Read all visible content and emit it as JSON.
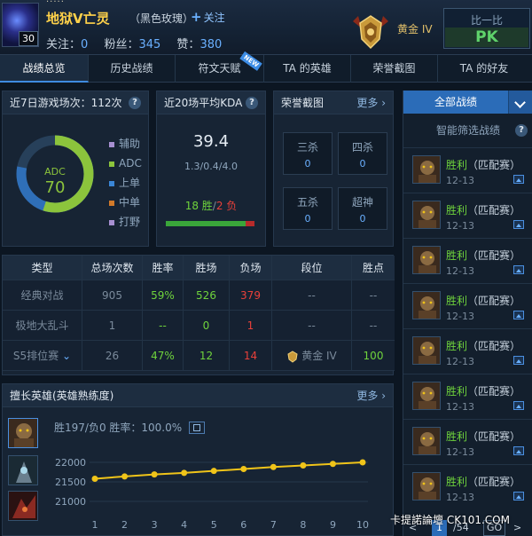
{
  "top_strip": "·····",
  "player": {
    "name": "地狱V亡灵",
    "title": "（黑色玫瑰）",
    "level": "30",
    "follow_label": "关注",
    "follows_label": "关注：",
    "follows": "0",
    "fans_label": "粉丝：",
    "fans": "345",
    "likes_label": "赞：",
    "likes": "380",
    "rank": "黄金 IV"
  },
  "compare": {
    "title": "比一比",
    "pk": "PK"
  },
  "tabs": [
    {
      "label": "战绩总览"
    },
    {
      "label": "历史战绩"
    },
    {
      "label": "符文天赋",
      "badge": "NEW"
    },
    {
      "label": "TA 的英雄"
    },
    {
      "label": "荣誉截图"
    },
    {
      "label": "TA 的好友"
    }
  ],
  "games_panel": {
    "title": "近7日游戏场次：112次",
    "center_role": "ADC",
    "center_value": "70",
    "legend": [
      {
        "label": "辅助",
        "color": "#a78fd1"
      },
      {
        "label": "ADC",
        "color": "#8cc43c"
      },
      {
        "label": "上单",
        "color": "#3a86d6"
      },
      {
        "label": "中单",
        "color": "#d27a2a"
      },
      {
        "label": "打野",
        "color": "#a78fd1"
      }
    ],
    "donut_colors": {
      "adc": "#8cc43c",
      "top": "#2f6fb8",
      "rest": "#27405a"
    }
  },
  "kda_panel": {
    "title": "近20场平均KDA",
    "kda": "39.4",
    "detail": "1.3/0.4/4.0",
    "wins": "18 胜",
    "sep": "/",
    "losses": "2 负",
    "win_ratio": 0.9
  },
  "honor_panel": {
    "title": "荣誉截图",
    "more": "更多",
    "cells": [
      {
        "name": "三杀",
        "value": "0"
      },
      {
        "name": "四杀",
        "value": "0"
      },
      {
        "name": "五杀",
        "value": "0"
      },
      {
        "name": "超神",
        "value": "0"
      }
    ]
  },
  "stats_table": {
    "headers": [
      "类型",
      "总场次数",
      "胜率",
      "胜场",
      "负场",
      "段位",
      "胜点"
    ],
    "rows": [
      {
        "type": "经典对战",
        "total": "905",
        "rate": "59%",
        "wins": "526",
        "losses": "379",
        "rank": "--",
        "points": "--"
      },
      {
        "type": "极地大乱斗",
        "total": "1",
        "rate": "--",
        "wins": "0",
        "losses": "1",
        "rank": "--",
        "points": "--"
      },
      {
        "type": "S5排位赛",
        "total": "26",
        "rate": "47%",
        "wins": "12",
        "losses": "14",
        "rank": "黄金 IV",
        "points": "100"
      }
    ]
  },
  "heroes_panel": {
    "title": "擅长英雄(英雄熟练度)",
    "more": "更多",
    "stats": "胜197/负0   胜率：100.0%"
  },
  "chart_data": {
    "type": "line",
    "x": [
      1,
      2,
      3,
      4,
      5,
      6,
      7,
      8,
      9,
      10
    ],
    "values": [
      21580,
      21640,
      21690,
      21730,
      21780,
      21830,
      21880,
      21920,
      21960,
      22000
    ],
    "ylim": [
      21000,
      22000
    ],
    "yticks": [
      "22000",
      "21500",
      "21000"
    ],
    "xticks": [
      "1",
      "2",
      "3",
      "4",
      "5",
      "6",
      "7",
      "8",
      "9",
      "10"
    ],
    "color": "#f0c419"
  },
  "right": {
    "all_games": "全部战绩",
    "smart_filter": "智能筛选战绩",
    "matches": [
      {
        "result": "胜利",
        "mode": "（匹配赛）",
        "date": "12-13"
      },
      {
        "result": "胜利",
        "mode": "（匹配赛）",
        "date": "12-13"
      },
      {
        "result": "胜利",
        "mode": "（匹配赛）",
        "date": "12-13"
      },
      {
        "result": "胜利",
        "mode": "（匹配赛）",
        "date": "12-13"
      },
      {
        "result": "胜利",
        "mode": "（匹配赛）",
        "date": "12-13"
      },
      {
        "result": "胜利",
        "mode": "（匹配赛）",
        "date": "12-13"
      },
      {
        "result": "胜利",
        "mode": "（匹配赛）",
        "date": "12-13"
      },
      {
        "result": "胜利",
        "mode": "（匹配赛）",
        "date": "12-13"
      }
    ],
    "pager": {
      "prev": "<",
      "page": "1",
      "total": "/54",
      "go": "GO",
      "next": ">"
    }
  },
  "watermark": "卡提諾論壇 CK101.COM"
}
